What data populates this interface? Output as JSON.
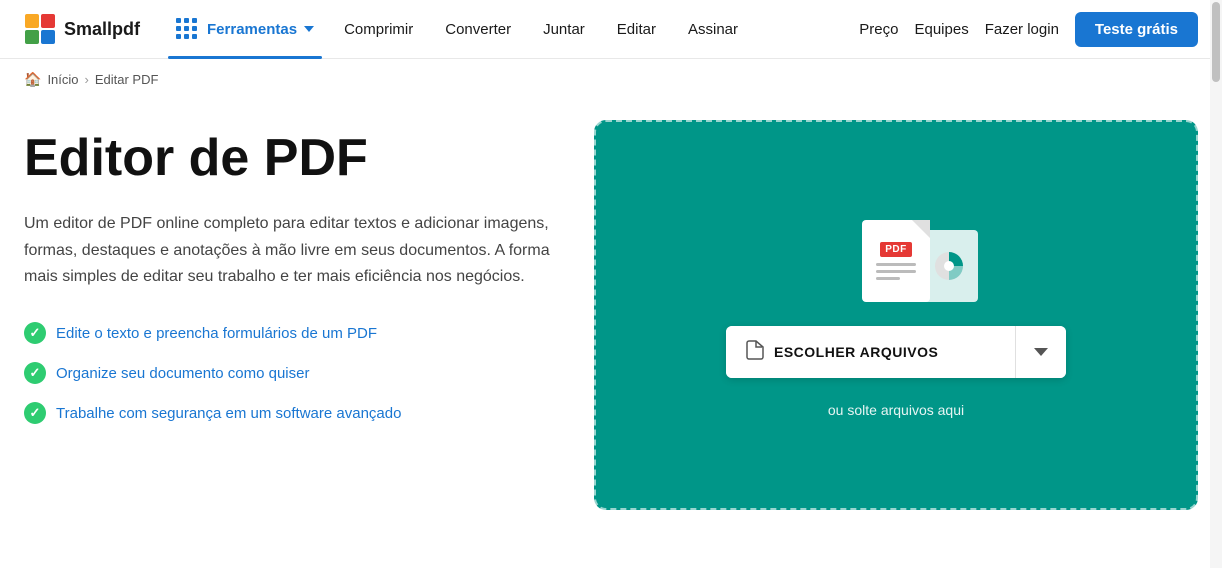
{
  "logo": {
    "text": "Smallpdf"
  },
  "header": {
    "ferramentas_label": "Ferramentas",
    "nav_items": [
      {
        "label": "Comprimir",
        "id": "comprimir"
      },
      {
        "label": "Converter",
        "id": "converter"
      },
      {
        "label": "Juntar",
        "id": "juntar"
      },
      {
        "label": "Editar",
        "id": "editar"
      },
      {
        "label": "Assinar",
        "id": "assinar"
      }
    ],
    "right_items": [
      {
        "label": "Preço",
        "id": "preco"
      },
      {
        "label": "Equipes",
        "id": "equipes"
      }
    ],
    "login_label": "Fazer login",
    "trial_label": "Teste grátis"
  },
  "breadcrumb": {
    "home_label": "Início",
    "separator": "›",
    "current": "Editar PDF"
  },
  "main": {
    "title": "Editor de PDF",
    "description": "Um editor de PDF online completo para editar textos e adicionar imagens, formas, destaques e anotações à mão livre em seus documentos. A forma mais simples de editar seu trabalho e ter mais eficiência nos negócios.",
    "features": [
      "Edite o texto e preencha formulários de um PDF",
      "Organize seu documento como quiser",
      "Trabalhe com segurança em um software avançado"
    ],
    "upload": {
      "choose_files_label": "ESCOLHER ARQUIVOS",
      "drop_hint": "ou solte arquivos aqui",
      "pdf_badge": "PDF"
    }
  }
}
